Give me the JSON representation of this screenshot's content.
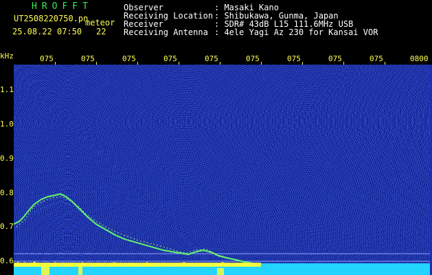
{
  "header": {
    "program_name": "HROFFT",
    "filename": "UT2508220750.pn",
    "file_tag": "meteor",
    "timestamp": "25.08.22 07:50",
    "count": "22",
    "observer_label": "Observer",
    "observer_value": ": Masaki Kano",
    "location_label": "Receiving Location",
    "location_value": ": Shibukawa, Gunma, Japan",
    "receiver_label": "Receiver",
    "receiver_value": ": SDR# 43dB L15 111.6MHz USB",
    "antenna_label": "Receiving Antenna",
    "antenna_value": ": 4ele Yagi Az 230 for Kansai VOR"
  },
  "axes": {
    "y_unit": "kHz",
    "y_ticks": [
      "1.1",
      "1.0",
      "0.9",
      "0.8",
      "0.7",
      "0.6"
    ],
    "x_ticks": [
      "075",
      "075",
      "075",
      "075",
      "075",
      "075",
      "075",
      "075",
      "075",
      "0800"
    ]
  },
  "colors": {
    "background": "#0a1a8c",
    "label_yellow": "#ffff55",
    "title_green": "#33ee55",
    "trace_green": "#66ff66",
    "bottom_cyan": "#22d4ff",
    "bottom_yellow": "#ffff33"
  }
}
